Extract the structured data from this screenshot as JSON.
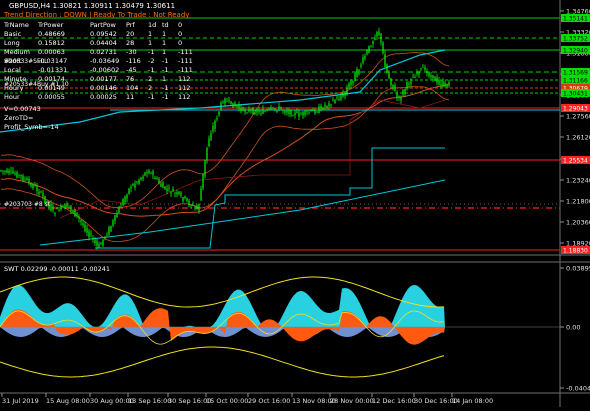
{
  "header": {
    "symbol_line": "GBPUSD,H4  1.30821 1.30911 1.30479 1.30611",
    "trend_line": "Trend Direction : DOWN | Ready To Trade : Not Ready"
  },
  "info_table": {
    "header": [
      "TrName",
      "TrPower",
      "PartPow",
      "Prf",
      "1d",
      "td",
      "0"
    ],
    "rows": [
      [
        "Basic",
        "0.48669",
        "0.09542",
        "20",
        "1",
        "1",
        "0"
      ],
      [
        "Long",
        "0.15812",
        "0.04404",
        "28",
        "1",
        "1",
        "0"
      ],
      [
        "Medium",
        "0.00063",
        "0.02731",
        "-30",
        "-1",
        "1",
        "-111"
      ],
      [
        "Short",
        "-0.03147",
        "-0.03649",
        "-116",
        "-2",
        "-1",
        "-111"
      ],
      [
        "Local",
        "-0.01331",
        "-0.00602",
        "-45",
        "-1",
        "-1",
        "-111"
      ],
      [
        "Minute",
        "0.00174",
        "0.00177",
        "76",
        "2",
        "1",
        "112"
      ],
      [
        "Houry",
        "0.00149",
        "0.00146",
        "104",
        "2",
        "-1",
        "112"
      ],
      [
        "Hour",
        "0.00055",
        "0.00025",
        "11",
        "-1",
        "-1",
        "112"
      ]
    ],
    "extra": [
      "V=0.00743",
      "ZeroTD=",
      "Profit_Symb=-14"
    ],
    "overlay_labels": [
      "#20533#SELL",
      "#20533#4Buy #1.10",
      "#203703 #8 st"
    ]
  },
  "price_axis": {
    "labels": [
      "1.34760",
      "1.33320",
      "1.31880",
      "1.30440",
      "1.29000",
      "1.27560",
      "1.26120",
      "1.24680",
      "1.23240",
      "1.21800",
      "1.20360",
      "1.18920"
    ],
    "badges": [
      {
        "text": "1.35141",
        "bg": "#00e000",
        "fg": "#000000"
      },
      {
        "text": "1.33752",
        "bg": "#00e000",
        "fg": "#000000"
      },
      {
        "text": "1.32940",
        "bg": "#00e000",
        "fg": "#000000"
      },
      {
        "text": "1.31569",
        "bg": "#00e000",
        "fg": "#000000"
      },
      {
        "text": "1.31166",
        "bg": "#00e000",
        "fg": "#000000"
      },
      {
        "text": "1.30679",
        "bg": "#d04000",
        "fg": "#ffffff"
      },
      {
        "text": "1.30431",
        "bg": "#00e000",
        "fg": "#000000"
      },
      {
        "text": "1.29043",
        "bg": "#ff2020",
        "fg": "#ffffff"
      },
      {
        "text": "1.25534",
        "bg": "#ff2020",
        "fg": "#ffffff"
      },
      {
        "text": "1.18830",
        "bg": "#ff2020",
        "fg": "#ffffff"
      }
    ]
  },
  "indicator": {
    "title": "SWT 0.02299 -0.00011 -0.00241",
    "axis_labels": [
      "0.03895",
      "0.00",
      "-0.04048"
    ]
  },
  "time_axis": {
    "labels": [
      "31 Jul 2019",
      "15 Aug 08:00",
      "30 Aug 00:00",
      "13 Sep 16:00",
      "30 Sep 16:00",
      "15 Oct 00:00",
      "29 Oct 16:00",
      "13 Nov 08:00",
      "28 Nov 00:00",
      "12 Dec 16:00",
      "30 Dec 16:00",
      "14 Jan 08:00"
    ]
  },
  "colors": {
    "background": "#000000",
    "candles": "#00ff00",
    "ma_cyan": "#00c8d8",
    "ma_orange": "#d05020",
    "resistance": "#00d000",
    "support": "#ff2020",
    "osc_fill_cyan": "#28d0e0",
    "osc_fill_orange": "#ff5a10",
    "osc_fill_blue": "#7090d0",
    "osc_yellow": "#f0e020",
    "header_text": "#ffffff",
    "trend_text": "#ff6a00"
  }
}
